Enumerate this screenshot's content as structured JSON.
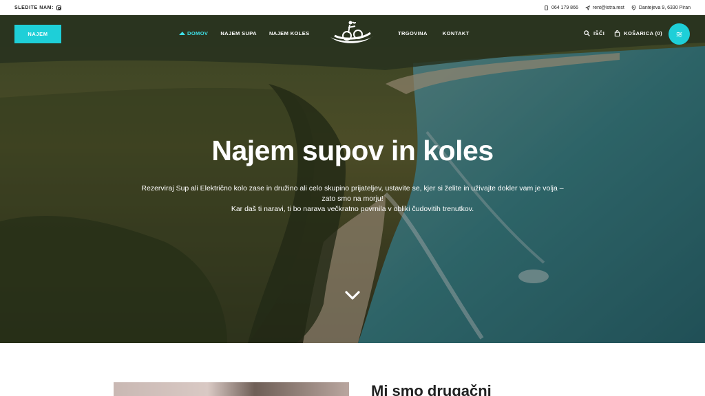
{
  "topbar": {
    "follow_label": "SLEDITE NAM:",
    "phone": "064 179 866",
    "email": "rent@istra.rest",
    "address": "Dantejeva 9, 6330 Piran"
  },
  "nav": {
    "cta_label": "NAJEM",
    "left_items": [
      "DOMOV",
      "NAJEM SUPA",
      "NAJEM KOLES"
    ],
    "right_items": [
      "TRGOVINA",
      "KONTAKT"
    ],
    "search_label": "IŠČI",
    "cart_label": "KOŠARICA (0)",
    "menu_glyph": "≋"
  },
  "hero": {
    "title": "Najem supov in koles",
    "subtitle_line1": "Rezerviraj Sup ali Električno kolo zase in družino ali celo skupino prijateljev, ustavite se, kjer si želite in uživajte dokler vam je volja –",
    "subtitle_line2": "zato smo na morju!",
    "subtitle_line3": "Kar daš ti naravi, ti bo narava večkratno povrnila v obliki čudovitih trenutkov."
  },
  "section": {
    "title": "Mi smo drugačni"
  },
  "colors": {
    "accent": "#1ecfd8",
    "active_link": "#3fe0e8"
  }
}
